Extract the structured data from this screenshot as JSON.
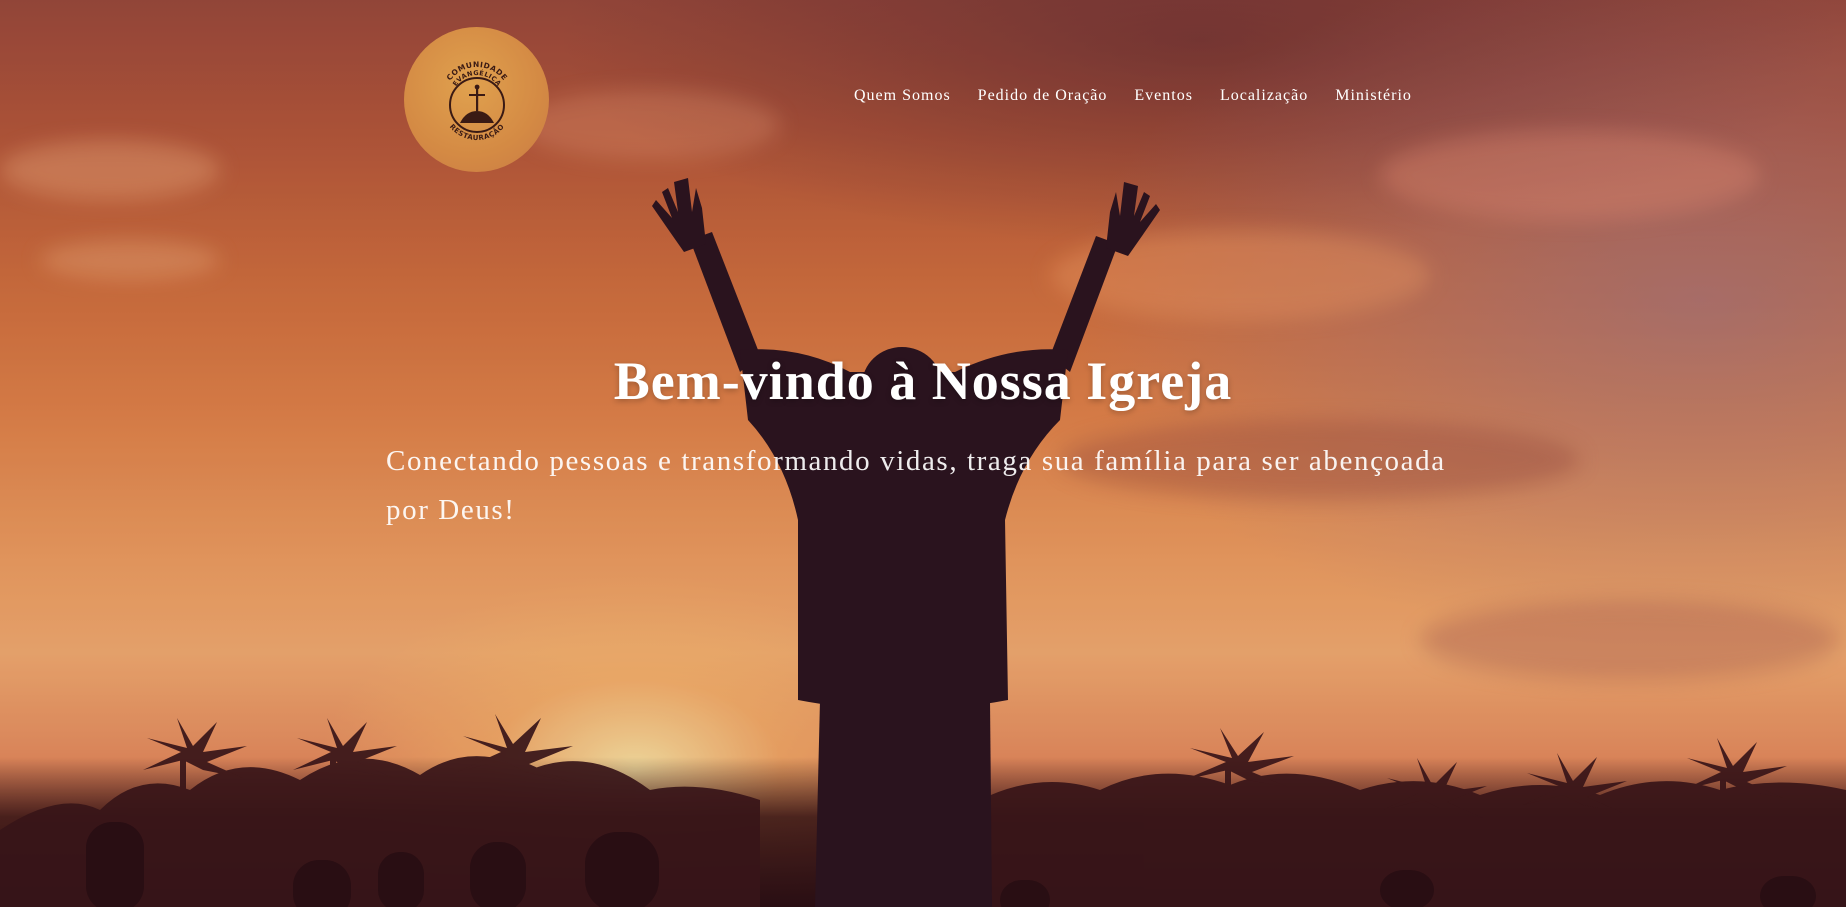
{
  "header": {
    "logo": {
      "text_top": "COMUNIDADE",
      "text_mid": "EVANGÉLICA",
      "text_bottom": "RESTAURAÇÃO"
    },
    "nav": [
      {
        "label": "Quem Somos"
      },
      {
        "label": "Pedido de Oração"
      },
      {
        "label": "Eventos"
      },
      {
        "label": "Localização"
      },
      {
        "label": "Ministério"
      }
    ]
  },
  "hero": {
    "title": "Bem-vindo à Nossa Igreja",
    "subtitle": "Conectando pessoas e transformando vidas, traga sua família para ser abençoada por Deus!"
  },
  "colors": {
    "logo_bg": "#d48a44",
    "logo_ink": "#3a1a14",
    "text": "#ffffff"
  }
}
